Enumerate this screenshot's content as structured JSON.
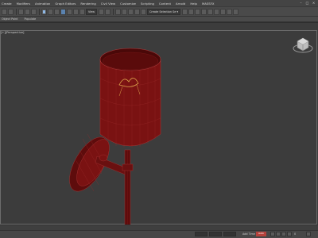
{
  "menu": {
    "items": [
      "Create",
      "Modifiers",
      "Animation",
      "Graph Editors",
      "Rendering",
      "Civil View",
      "Customize",
      "Scripting",
      "Content",
      "Arnold",
      "Help",
      "MASSFX"
    ],
    "close_glyph": "×",
    "minimize_glyph": "–",
    "maximize_glyph": "□"
  },
  "toolbar": {
    "view_dropdown": "View",
    "selection_set_dropdown": "Create Selection Se ▾"
  },
  "ribbon": {
    "tabs": [
      "Object Paint",
      "Populate"
    ]
  },
  "viewport": {
    "label": "[+][Perspective]"
  },
  "status": {
    "add_time_tag": "Add Time Tag",
    "auto_key": "Auto",
    "frame": "0"
  },
  "colors": {
    "lamp_body": "#7a1212",
    "lamp_wire": "#a83535",
    "filament": "#d9a24a",
    "viewport_bg": "#3c3c3c",
    "accent_blue": "#5b83b0"
  }
}
